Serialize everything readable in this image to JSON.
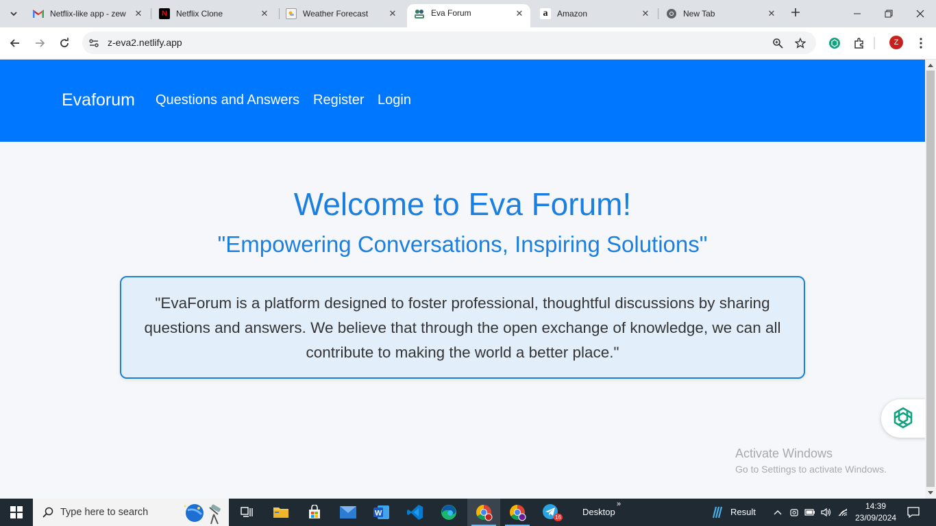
{
  "browser": {
    "tabs": [
      {
        "title": "Netflix-like app - zew",
        "favicon": "gmail-icon",
        "active": false
      },
      {
        "title": "Netflix Clone",
        "favicon": "netflix-icon",
        "active": false
      },
      {
        "title": "Weather Forecast",
        "favicon": "weather-icon",
        "active": false
      },
      {
        "title": "Eva Forum",
        "favicon": "eva-forum-icon",
        "active": true
      },
      {
        "title": "Amazon",
        "favicon": "amazon-icon",
        "active": false
      },
      {
        "title": "New Tab",
        "favicon": "chrome-icon",
        "active": false
      }
    ],
    "url": "z-eva2.netlify.app",
    "profile_initial": "Z"
  },
  "site": {
    "brand": "Evaforum",
    "nav": [
      "Questions and Answers",
      "Register",
      "Login"
    ],
    "hero_title": "Welcome to Eva Forum!",
    "hero_subtitle": "\"Empowering Conversations, Inspiring Solutions\"",
    "about": "\"EvaForum is a platform designed to foster professional, thoughtful discussions by sharing questions and answers. We believe that through the open exchange of knowledge, we can all contribute to making the world a better place.\"",
    "colors": {
      "nav_bg": "#0077ff",
      "accent": "#1a7fe0",
      "box_border": "#1a7fd4",
      "box_bg": "#e3eefb"
    }
  },
  "watermark": {
    "line1": "Activate Windows",
    "line2": "Go to Settings to activate Windows."
  },
  "taskbar": {
    "search_placeholder": "Type here to search",
    "desktop_label": "Desktop",
    "weather_label": "Result",
    "telegram_badge": "16",
    "time": "14:39",
    "date": "23/09/2024"
  }
}
